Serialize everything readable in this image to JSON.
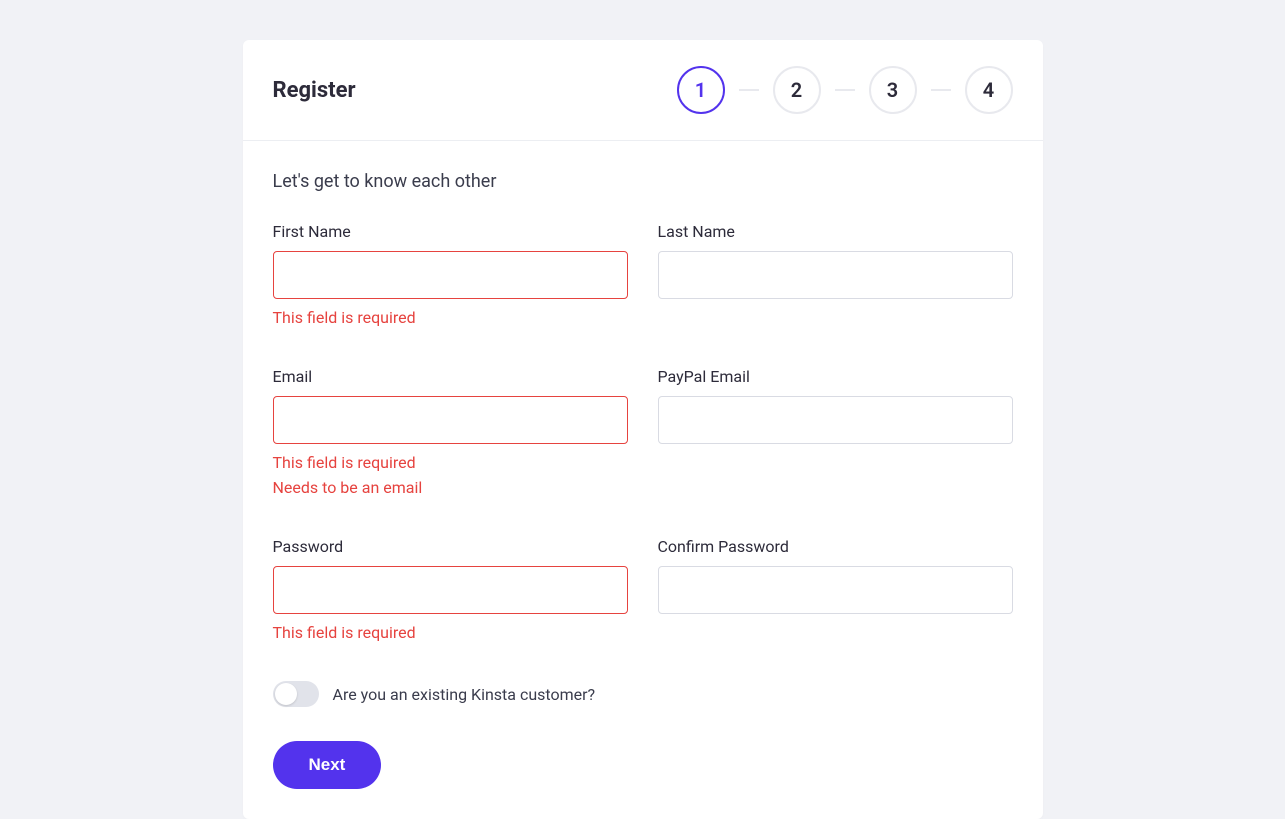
{
  "header": {
    "title": "Register",
    "steps": [
      "1",
      "2",
      "3",
      "4"
    ],
    "active_step": 0
  },
  "body": {
    "subtitle": "Let's get to know each other",
    "fields": {
      "first_name": {
        "label": "First Name",
        "value": "",
        "errors": "This field is required"
      },
      "last_name": {
        "label": "Last Name",
        "value": "",
        "errors": ""
      },
      "email": {
        "label": "Email",
        "value": "",
        "errors": "This field is required\nNeeds to be an email"
      },
      "paypal_email": {
        "label": "PayPal Email",
        "value": "",
        "errors": ""
      },
      "password": {
        "label": "Password",
        "value": "",
        "errors": "This field is required"
      },
      "confirm_password": {
        "label": "Confirm Password",
        "value": "",
        "errors": ""
      }
    },
    "toggle": {
      "label": "Are you an existing Kinsta customer?",
      "value": false
    },
    "next_button": "Next"
  },
  "colors": {
    "accent": "#5333ed",
    "error": "#e6433f"
  }
}
